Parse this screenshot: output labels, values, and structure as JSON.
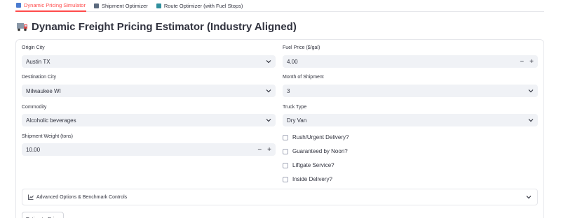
{
  "tabs": [
    {
      "label": "Dynamic Pricing Simulator",
      "icon": "truck-icon",
      "active": true
    },
    {
      "label": "Shipment Optimizer",
      "icon": "chart-icon",
      "active": false
    },
    {
      "label": "Route Optimizer (with Fuel Stops)",
      "icon": "map-icon",
      "active": false
    }
  ],
  "page": {
    "title": "Dynamic Freight Pricing Estimator (Industry Aligned)",
    "title_icon": "truck-icon"
  },
  "form": {
    "origin_city": {
      "label": "Origin City",
      "value": "Austin TX"
    },
    "destination_city": {
      "label": "Destination City",
      "value": "Milwaukee WI"
    },
    "commodity": {
      "label": "Commodity",
      "value": "Alcoholic beverages"
    },
    "shipment_weight": {
      "label": "Shipment Weight (tons)",
      "value": "10.00",
      "minus": "−",
      "plus": "+"
    },
    "fuel_price": {
      "label": "Fuel Price ($/gal)",
      "value": "4.00",
      "minus": "−",
      "plus": "+"
    },
    "month": {
      "label": "Month of Shipment",
      "value": "3"
    },
    "truck_type": {
      "label": "Truck Type",
      "value": "Dry Van"
    },
    "checkboxes": {
      "rush": "Rush/Urgent Delivery?",
      "noon": "Guaranteed by Noon?",
      "liftgate": "Liftgate Service?",
      "inside": "Inside Delivery?"
    }
  },
  "expander": {
    "label": "Advanced Options & Benchmark Controls",
    "icon": "bar-chart-icon"
  },
  "submit": {
    "label": "Estimate Price"
  },
  "colors": {
    "accent": "#ff4b4b",
    "input_bg": "#f0f2f6",
    "text": "#31333f"
  }
}
